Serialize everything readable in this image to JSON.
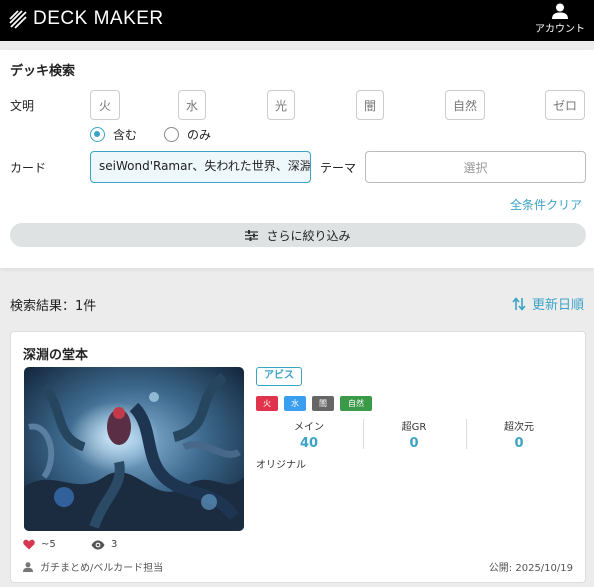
{
  "header": {
    "logo_text": "DECK MAKER",
    "account_label": "アカウント",
    "icons": {
      "logo": "stripes-logo-icon",
      "account": "person-icon"
    }
  },
  "search": {
    "title": "デッキ検索",
    "civ_label": "文明",
    "civilizations": [
      "火",
      "水",
      "光",
      "闇",
      "自然",
      "ゼロ"
    ],
    "match_options": [
      {
        "label": "含む",
        "selected": true
      },
      {
        "label": "のみ",
        "selected": false
      }
    ],
    "card_label": "カード",
    "card_value": "seiWond'Ramar、失われた世界、深淵の堂本",
    "theme_label": "テーマ",
    "theme_placeholder": "選択",
    "clear_label": "全条件クリア",
    "narrow_label": "さらに絞り込み",
    "narrow_icon": "sliders-icon"
  },
  "results": {
    "label": "検索結果：1件",
    "sort_label": "更新日順",
    "sort_icon": "sort-arrows-icon"
  },
  "deck": {
    "name": "深淵の堂本",
    "theme": "アビス",
    "civilizations": [
      {
        "name": "火",
        "color": "#e0344d"
      },
      {
        "name": "水",
        "color": "#3a9ff0"
      },
      {
        "name": "闇",
        "color": "#666666"
      },
      {
        "name": "自然",
        "color": "#3a9a48"
      }
    ],
    "counts": [
      {
        "label": "メイン",
        "value": "40"
      },
      {
        "label": "超GR",
        "value": "0"
      },
      {
        "label": "超次元",
        "value": "0"
      }
    ],
    "format": "オリジナル",
    "likes": "~5",
    "views": "3",
    "author": "ガチまとめ/ベルカード担当",
    "published": "公開: 2025/10/19"
  },
  "colors": {
    "accent": "#3ba3c5",
    "header_bg": "#000000",
    "page_bg": "#ececec",
    "like": "#d6364f"
  }
}
